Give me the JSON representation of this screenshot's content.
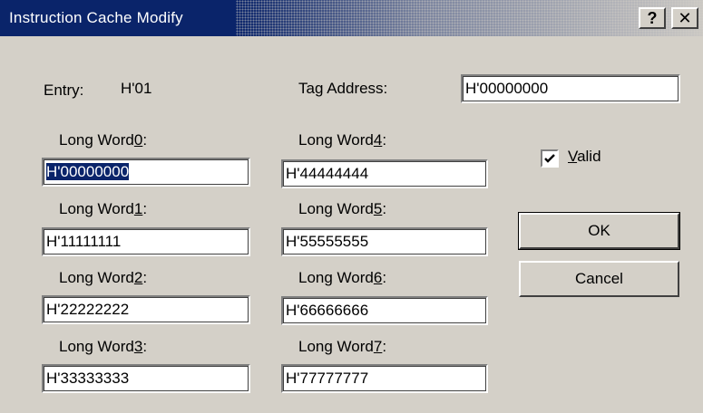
{
  "window": {
    "title": "Instruction Cache Modify",
    "help_glyph": "?",
    "close_glyph": "✕"
  },
  "entry": {
    "label": "Entry:",
    "value": "H'01"
  },
  "tag_address": {
    "label": "Tag Address:",
    "value": "H'00000000"
  },
  "long_words": [
    {
      "prefix": "Long Word",
      "key": "0",
      "suffix": ":",
      "value": "H'00000000"
    },
    {
      "prefix": "Long Word",
      "key": "1",
      "suffix": ":",
      "value": "H'11111111"
    },
    {
      "prefix": "Long Word",
      "key": "2",
      "suffix": ":",
      "value": "H'22222222"
    },
    {
      "prefix": "Long Word",
      "key": "3",
      "suffix": ":",
      "value": "H'33333333"
    },
    {
      "prefix": "Long Word",
      "key": "4",
      "suffix": ":",
      "value": "H'44444444"
    },
    {
      "prefix": "Long Word",
      "key": "5",
      "suffix": ":",
      "value": "H'55555555"
    },
    {
      "prefix": "Long Word",
      "key": "6",
      "suffix": ":",
      "value": "H'66666666"
    },
    {
      "prefix": "Long Word",
      "key": "7",
      "suffix": ":",
      "value": "H'77777777"
    }
  ],
  "valid": {
    "key": "V",
    "rest": "alid",
    "checked": true
  },
  "buttons": {
    "ok": "OK",
    "cancel": "Cancel"
  }
}
